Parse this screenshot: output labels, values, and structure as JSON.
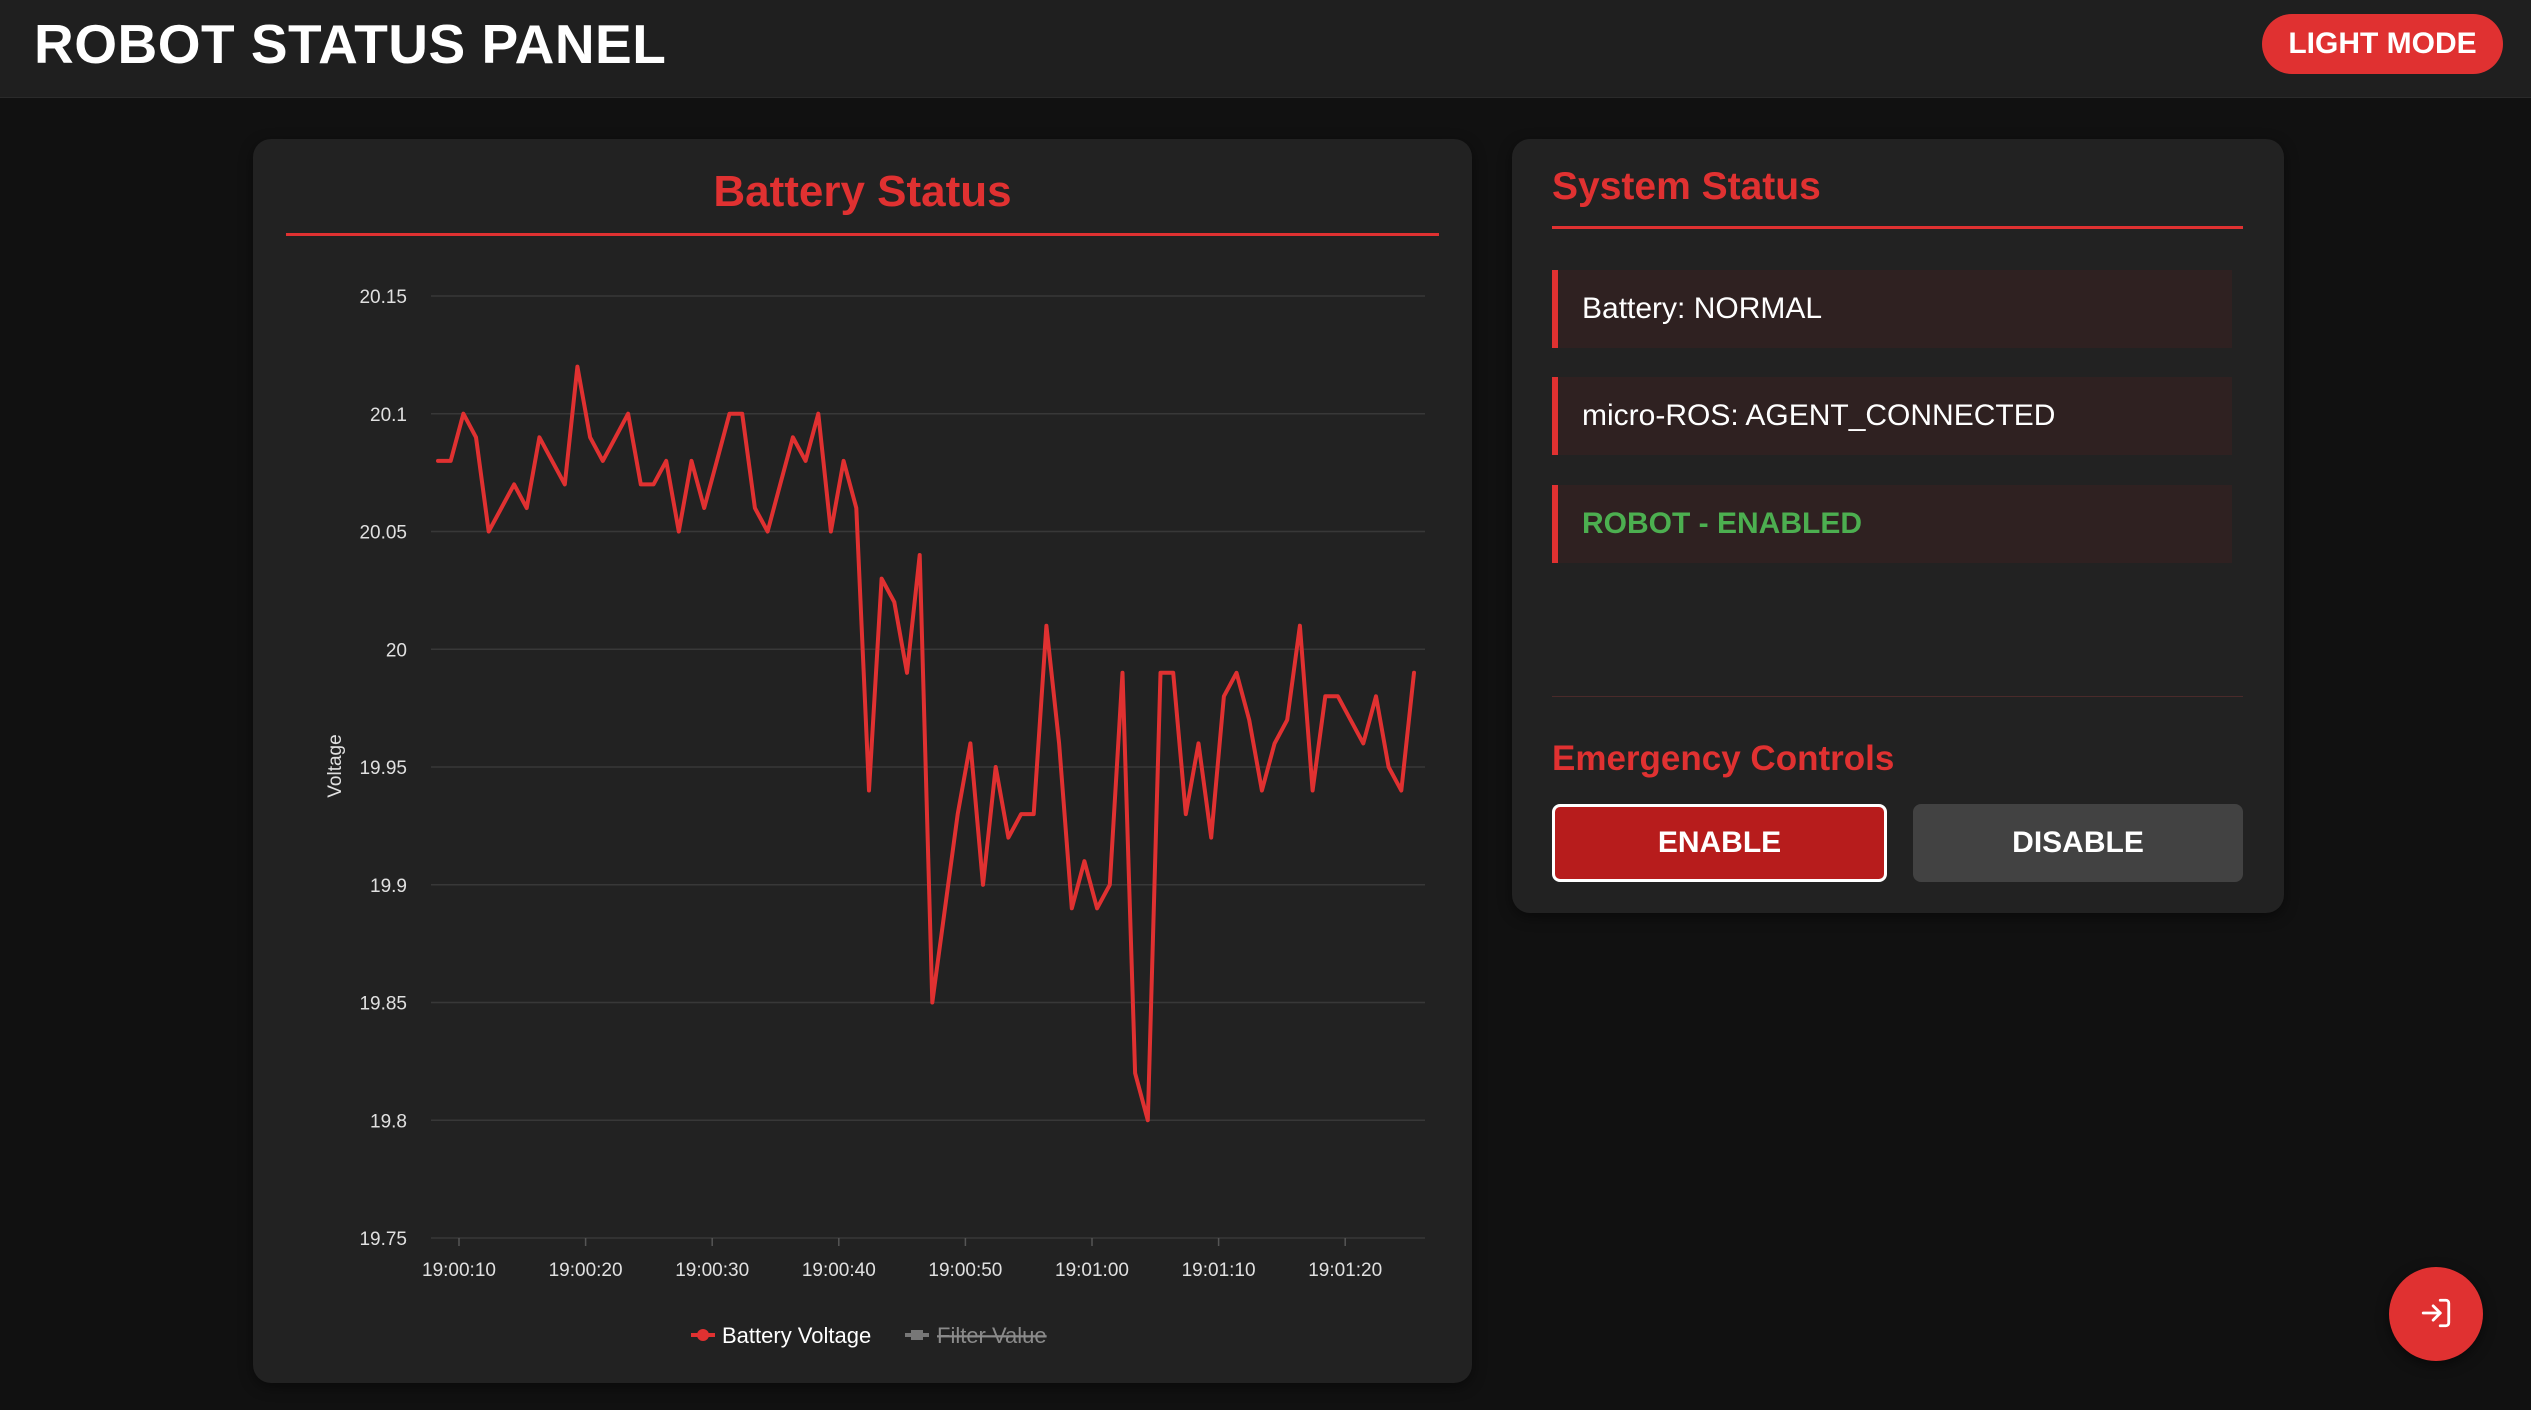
{
  "header": {
    "title": "ROBOT STATUS PANEL",
    "theme_toggle_label": "LIGHT MODE"
  },
  "battery_panel": {
    "title": "Battery Status"
  },
  "chart_data": {
    "type": "line",
    "title": "",
    "xlabel": "",
    "ylabel": "Voltage",
    "ylim": [
      19.75,
      20.15
    ],
    "yticks": [
      "20.15",
      "20.1",
      "20.05",
      "20",
      "19.95",
      "19.9",
      "19.85",
      "19.8",
      "19.75"
    ],
    "ytick_values": [
      20.15,
      20.1,
      20.05,
      20.0,
      19.95,
      19.9,
      19.85,
      19.8,
      19.75
    ],
    "xticks": [
      "19:00:10",
      "19:00:20",
      "19:00:30",
      "19:00:40",
      "19:00:50",
      "19:01:00",
      "19:01:10",
      "19:01:20"
    ],
    "grid": true,
    "legend_position": "bottom",
    "series": [
      {
        "name": "Battery Voltage",
        "color": "#e03131",
        "hidden": false,
        "values": [
          20.08,
          20.08,
          20.1,
          20.09,
          20.05,
          20.06,
          20.07,
          20.06,
          20.09,
          20.08,
          20.07,
          20.12,
          20.09,
          20.08,
          20.09,
          20.1,
          20.07,
          20.07,
          20.08,
          20.05,
          20.08,
          20.06,
          20.08,
          20.1,
          20.1,
          20.06,
          20.05,
          20.07,
          20.09,
          20.08,
          20.1,
          20.05,
          20.08,
          20.06,
          19.94,
          20.03,
          20.02,
          19.99,
          20.04,
          19.85,
          19.89,
          19.93,
          19.96,
          19.9,
          19.95,
          19.92,
          19.93,
          19.93,
          20.01,
          19.96,
          19.89,
          19.91,
          19.89,
          19.9,
          19.99,
          19.82,
          19.8,
          19.99,
          19.99,
          19.93,
          19.96,
          19.92,
          19.98,
          19.99,
          19.97,
          19.94,
          19.96,
          19.97,
          20.01,
          19.94,
          19.98,
          19.98,
          19.97,
          19.96,
          19.98,
          19.95,
          19.94,
          19.99
        ]
      },
      {
        "name": "Filter Value",
        "color": "#777777",
        "hidden": true,
        "values": []
      }
    ]
  },
  "system_panel": {
    "title": "System Status",
    "items": [
      {
        "label": "Battery: NORMAL"
      },
      {
        "label": "micro-ROS: AGENT_CONNECTED"
      },
      {
        "label": "ROBOT - ENABLED"
      }
    ],
    "emergency_title": "Emergency Controls",
    "enable_label": "ENABLE",
    "disable_label": "DISABLE"
  },
  "fab": {
    "icon": "login-icon"
  }
}
